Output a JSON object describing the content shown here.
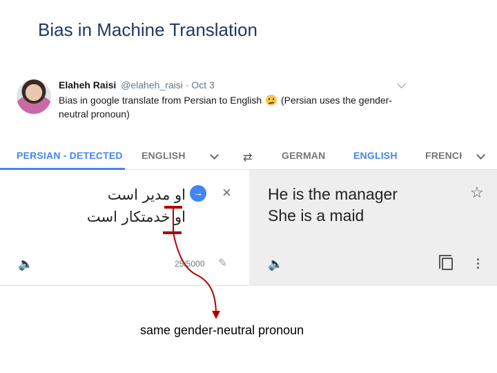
{
  "slide": {
    "title": "Bias in Machine Translation",
    "caption": "same gender-neutral pronoun"
  },
  "tweet": {
    "name": "Elaheh Raisi",
    "handle": "@elaheh_raisi · Oct 3",
    "text_before_emoji": "Bias in google translate from Persian to English",
    "text_after_emoji": "(Persian uses the gender-neutral pronoun)",
    "emoji_icon": "rolling-eyes-emoji"
  },
  "translate": {
    "tabs": {
      "persian_detected": "PERSIAN - DETECTED",
      "source_english": "ENGLISH",
      "german": "GERMAN",
      "target_english": "ENGLISH",
      "french": "FRENCH"
    },
    "source_lines": [
      "او مدیر است",
      "او خدمتکار است"
    ],
    "char_count": "25/5000",
    "target_lines": [
      "He is the manager",
      "She is a maid"
    ],
    "icons": {
      "go": "→",
      "clear": "×",
      "swap": "⇄",
      "speaker": "🔈",
      "pencil": "✎",
      "star": "☆",
      "more": "⋮"
    },
    "accent_color": "#4285f4",
    "highlight_color": "#b00000"
  }
}
